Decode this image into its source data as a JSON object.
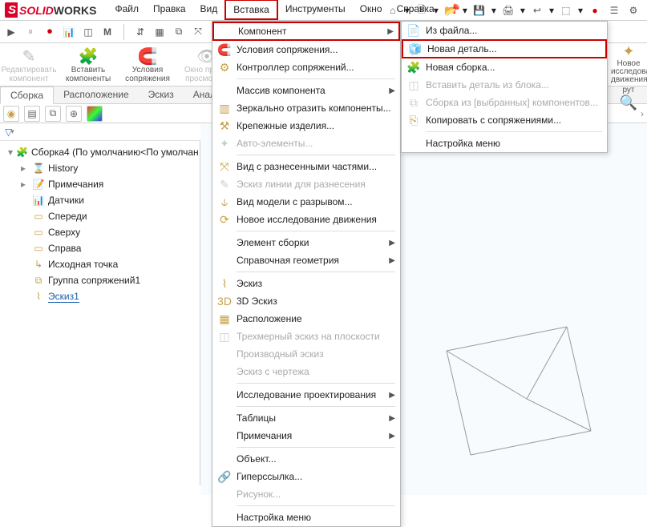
{
  "app": {
    "brand_solid": "SOLID",
    "brand_works": "WORKS"
  },
  "menubar": [
    "Файл",
    "Правка",
    "Вид",
    "Вставка",
    "Инструменты",
    "Окно",
    "Справка"
  ],
  "menubar_hl_index": 3,
  "ribbon": [
    {
      "label": "Редактировать\nкомпонент",
      "dis": true
    },
    {
      "label": "Вставить\nкомпоненты",
      "dis": false
    },
    {
      "label": "Условия\nсопряжения",
      "dis": false
    },
    {
      "label": "Окно предв.\nпросмотрак",
      "dis": true
    }
  ],
  "rightstrip": [
    {
      "label": "Новое\nисследование\nдвижения"
    },
    {
      "label": "рут"
    }
  ],
  "tabs": [
    "Сборка",
    "Расположение",
    "Эскиз",
    "Анализировать"
  ],
  "tree": {
    "root": "Сборка4 (По умолчанию<По умолчан",
    "items": [
      {
        "icon": "⌛",
        "label": "History"
      },
      {
        "icon": "📝",
        "label": "Примечания"
      },
      {
        "icon": "📊",
        "label": "Датчики"
      },
      {
        "icon": "▭",
        "label": "Спереди"
      },
      {
        "icon": "▭",
        "label": "Сверху"
      },
      {
        "icon": "▭",
        "label": "Справа"
      },
      {
        "icon": "↳",
        "label": "Исходная точка"
      },
      {
        "icon": "⧉",
        "label": "Группа сопряжений1"
      },
      {
        "icon": "⌇",
        "label": "Эскиз1",
        "selected": true
      }
    ]
  },
  "menu1": [
    {
      "type": "item",
      "label": "Компонент",
      "arrow": true,
      "hl": true,
      "icon": ""
    },
    {
      "type": "item",
      "label": "Условия сопряжения...",
      "icon": "🧲"
    },
    {
      "type": "item",
      "label": "Контроллер сопряжений...",
      "icon": "⚙"
    },
    {
      "type": "sep"
    },
    {
      "type": "item",
      "label": "Массив компонента",
      "arrow": true,
      "icon": ""
    },
    {
      "type": "item",
      "label": "Зеркально отразить компоненты...",
      "icon": "▥"
    },
    {
      "type": "item",
      "label": "Крепежные изделия...",
      "icon": "⚒"
    },
    {
      "type": "item",
      "label": "Авто-элементы...",
      "dis": true,
      "icon": "✦"
    },
    {
      "type": "sep"
    },
    {
      "type": "item",
      "label": "Вид с разнесенными частями...",
      "icon": "⤧"
    },
    {
      "type": "item",
      "label": "Эскиз линии для разнесения",
      "dis": true,
      "icon": "✎"
    },
    {
      "type": "item",
      "label": "Вид модели с разрывом...",
      "icon": "⫝"
    },
    {
      "type": "item",
      "label": "Новое исследование движения",
      "icon": "⟳"
    },
    {
      "type": "sep"
    },
    {
      "type": "item",
      "label": "Элемент сборки",
      "arrow": true,
      "icon": ""
    },
    {
      "type": "item",
      "label": "Справочная геометрия",
      "arrow": true,
      "icon": ""
    },
    {
      "type": "sep"
    },
    {
      "type": "item",
      "label": "Эскиз",
      "icon": "⌇"
    },
    {
      "type": "item",
      "label": "3D Эскиз",
      "icon": "3D"
    },
    {
      "type": "item",
      "label": "Расположение",
      "icon": "▦"
    },
    {
      "type": "item",
      "label": "Трехмерный эскиз на плоскости",
      "dis": true,
      "icon": "◫"
    },
    {
      "type": "item",
      "label": "Производный эскиз",
      "dis": true,
      "icon": ""
    },
    {
      "type": "item",
      "label": "Эскиз с чертежа",
      "dis": true,
      "icon": ""
    },
    {
      "type": "sep"
    },
    {
      "type": "item",
      "label": "Исследование проектирования",
      "arrow": true,
      "icon": ""
    },
    {
      "type": "sep"
    },
    {
      "type": "item",
      "label": "Таблицы",
      "arrow": true,
      "icon": ""
    },
    {
      "type": "item",
      "label": "Примечания",
      "arrow": true,
      "icon": ""
    },
    {
      "type": "sep"
    },
    {
      "type": "item",
      "label": "Объект...",
      "icon": ""
    },
    {
      "type": "item",
      "label": "Гиперссылка...",
      "icon": "🔗"
    },
    {
      "type": "item",
      "label": "Рисунок...",
      "dis": true,
      "icon": ""
    },
    {
      "type": "sep"
    },
    {
      "type": "item",
      "label": "Настройка меню",
      "icon": ""
    }
  ],
  "menu2": [
    {
      "type": "item",
      "label": "Из файла...",
      "icon": "📄"
    },
    {
      "type": "item",
      "label": "Новая деталь...",
      "icon": "🧊",
      "hl": true
    },
    {
      "type": "item",
      "label": "Новая сборка...",
      "icon": "🧩"
    },
    {
      "type": "item",
      "label": "Вставить деталь из блока...",
      "dis": true,
      "icon": "◫"
    },
    {
      "type": "item",
      "label": "Сборка из [выбранных] компонентов...",
      "dis": true,
      "icon": "⧉"
    },
    {
      "type": "item",
      "label": "Копировать с сопряжениями...",
      "icon": "⎘"
    },
    {
      "type": "sep"
    },
    {
      "type": "item",
      "label": "Настройка меню",
      "icon": ""
    }
  ]
}
